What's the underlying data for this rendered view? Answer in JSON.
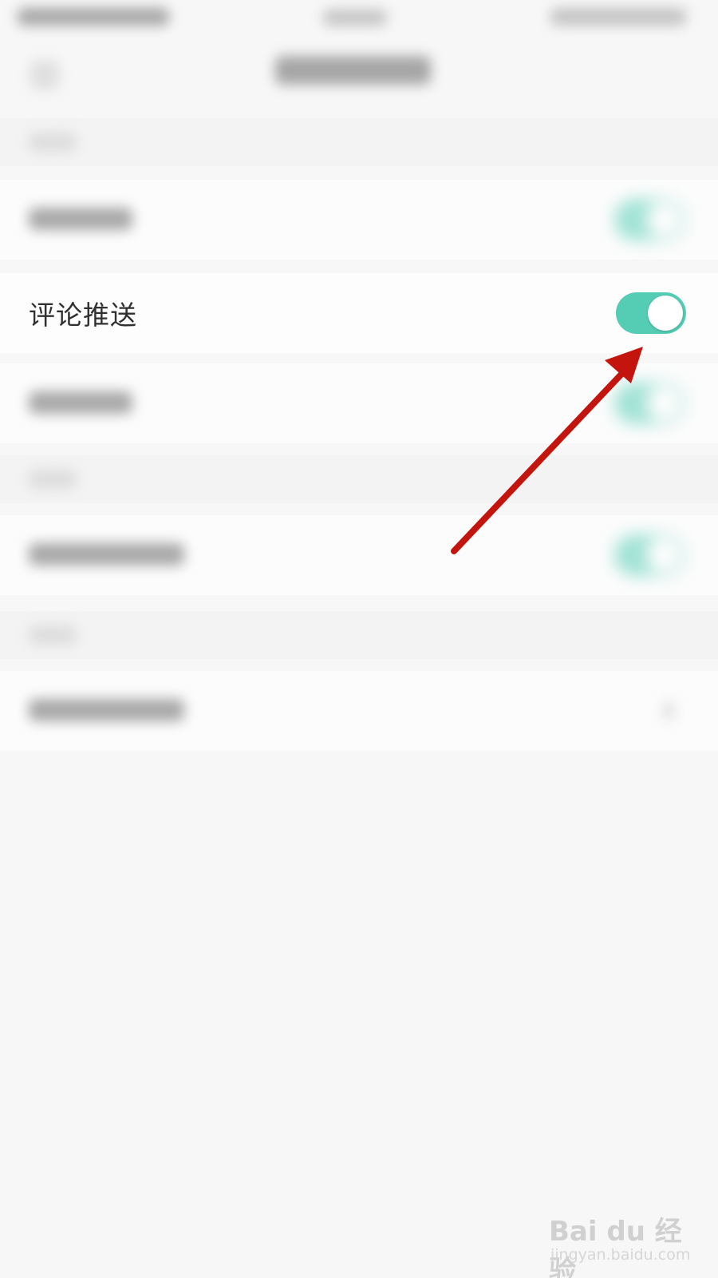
{
  "settings": {
    "comment_push": {
      "label": "评论推送",
      "enabled": true
    }
  },
  "colors": {
    "toggle_on": "#55cdb5",
    "arrow": "#c3150d",
    "background": "#f7f7f7"
  },
  "watermark": {
    "logo_text": "Bai du 经验",
    "sub_text": "jingyan.baidu.com"
  }
}
